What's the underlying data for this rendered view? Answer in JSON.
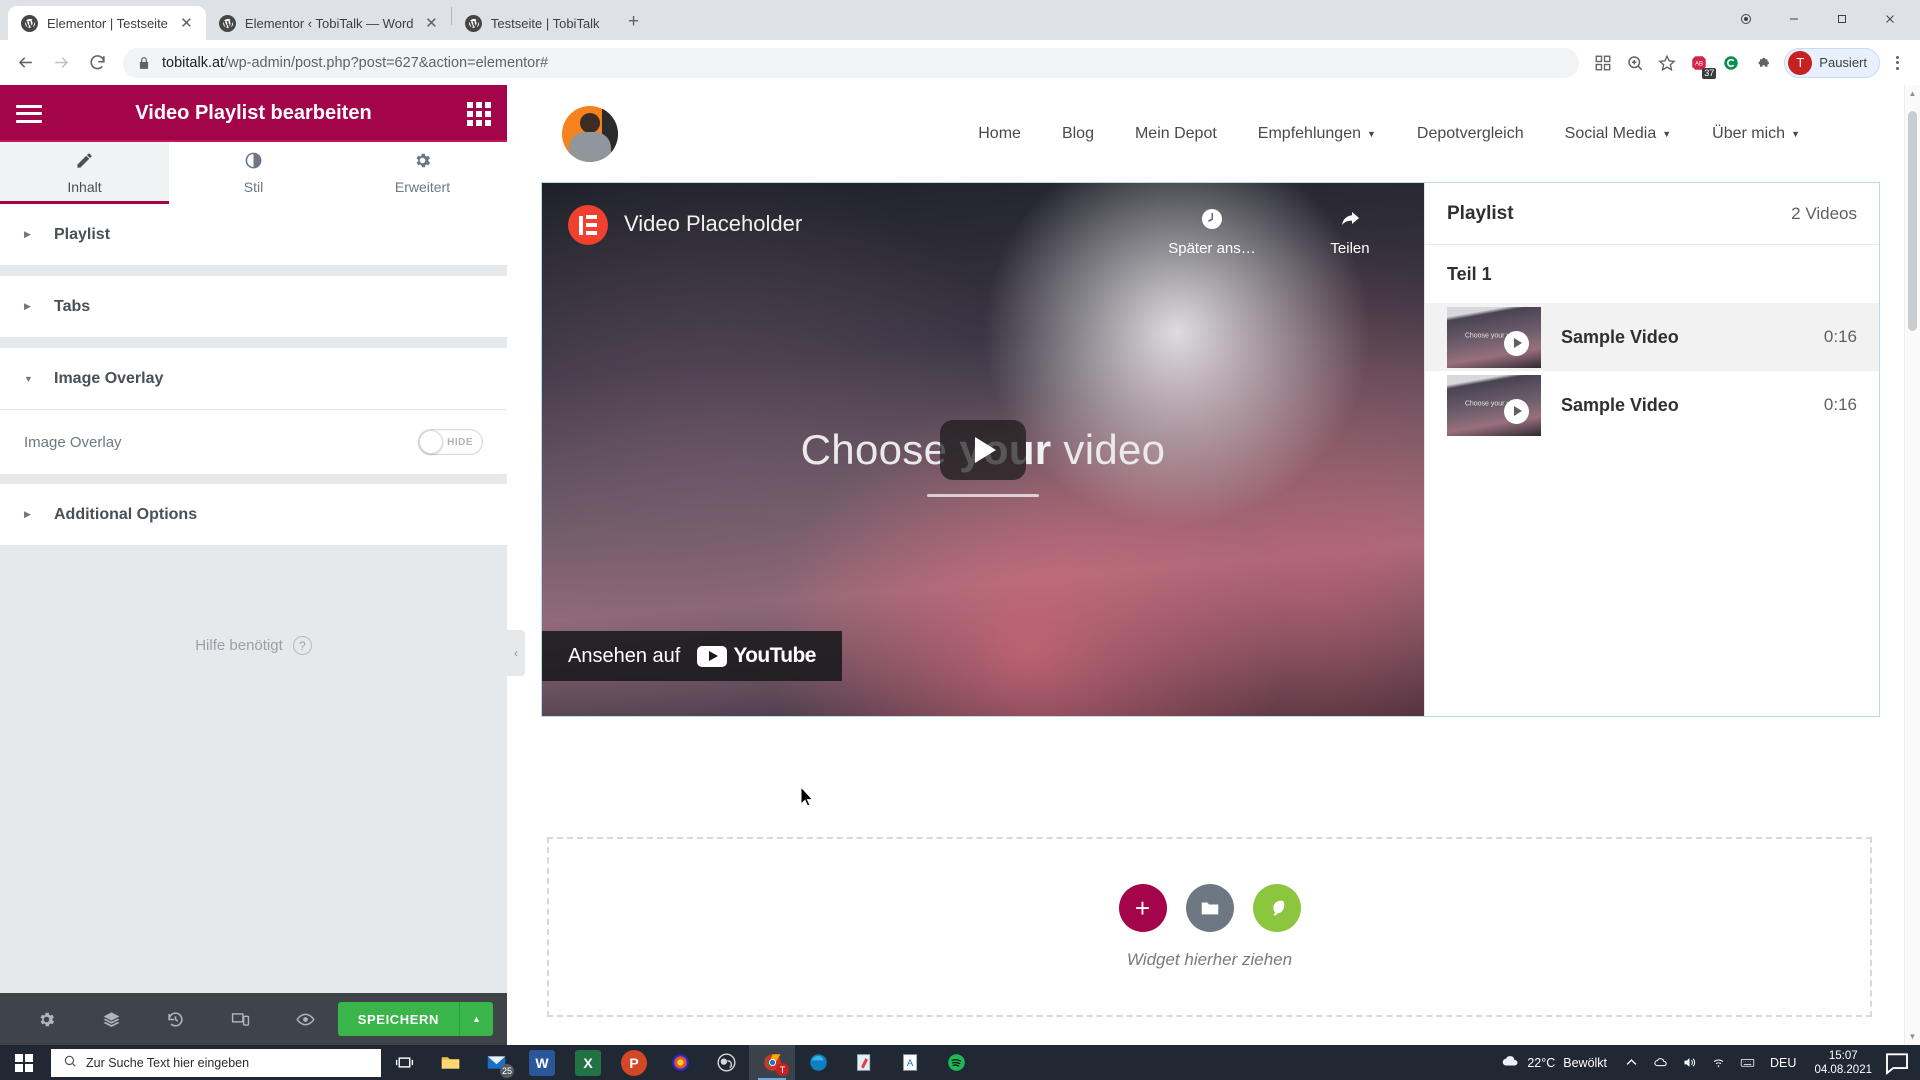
{
  "browser": {
    "tabs": [
      {
        "title": "Elementor | Testseite",
        "active": true,
        "icon": "wordpress-icon"
      },
      {
        "title": "Elementor ‹ TobiTalk — WordPre",
        "active": false,
        "icon": "wordpress-icon"
      },
      {
        "title": "Testseite | TobiTalk",
        "active": false,
        "icon": "wordpress-icon"
      }
    ],
    "new_tab_label": "+",
    "window_controls": {
      "minimize": "–",
      "maximize": "▢",
      "close": "✕"
    },
    "url_host": "tobitalk.at",
    "url_path": "/wp-admin/post.php?post=627&action=elementor#",
    "extensions": [
      {
        "name": "qr-code-icon",
        "badge": ""
      },
      {
        "name": "zoom-search-icon",
        "badge": ""
      },
      {
        "name": "bookmark-star-icon",
        "badge": ""
      },
      {
        "name": "adblock-icon",
        "badge": "37"
      },
      {
        "name": "cookie-consent-icon",
        "badge": ""
      },
      {
        "name": "extensions-puzzle-icon",
        "badge": ""
      }
    ],
    "profile": {
      "initial": "T",
      "status": "Pausiert"
    }
  },
  "panel": {
    "title": "Video Playlist bearbeiten",
    "menu_icon": "hamburger-menu-icon",
    "widgets_icon": "widgets-grid-icon",
    "tabs": [
      {
        "label": "Inhalt",
        "icon": "pencil-icon",
        "active": true
      },
      {
        "label": "Stil",
        "icon": "contrast-circle-icon",
        "active": false
      },
      {
        "label": "Erweitert",
        "icon": "gear-icon",
        "active": false
      }
    ],
    "sections": [
      {
        "label": "Playlist",
        "expanded": false
      },
      {
        "label": "Tabs",
        "expanded": false
      },
      {
        "label": "Image Overlay",
        "expanded": true
      },
      {
        "label": "Additional Options",
        "expanded": false
      }
    ],
    "image_overlay_control": {
      "label": "Image Overlay",
      "switch_label": "HIDE",
      "state": "off"
    },
    "help": {
      "label": "Hilfe benötigt",
      "icon": "question-mark-icon"
    },
    "footer": {
      "icons": [
        "settings-gear-icon",
        "navigator-layers-icon",
        "history-icon",
        "responsive-mode-icon",
        "preview-eye-icon"
      ],
      "save_label": "SPEICHERN",
      "save_caret": "▲"
    },
    "collapse_handle": "‹",
    "accent_color": "#a4054a",
    "save_color": "#39b54a"
  },
  "site": {
    "logo_alt": "profile-avatar",
    "nav": [
      {
        "label": "Home",
        "has_dropdown": false
      },
      {
        "label": "Blog",
        "has_dropdown": false
      },
      {
        "label": "Mein Depot",
        "has_dropdown": false
      },
      {
        "label": "Empfehlungen",
        "has_dropdown": true
      },
      {
        "label": "Depotvergleich",
        "has_dropdown": false
      },
      {
        "label": "Social Media",
        "has_dropdown": true
      },
      {
        "label": "Über mich",
        "has_dropdown": true
      }
    ],
    "video": {
      "title": "Video Placeholder",
      "brand_icon": "elementor-logo-icon",
      "actions": [
        {
          "label": "Später ans…",
          "icon": "watch-later-clock-icon"
        },
        {
          "label": "Teilen",
          "icon": "share-arrow-icon"
        }
      ],
      "center_text_1": "Choose ",
      "center_text_bold": "your",
      "center_text_2": " video",
      "watch_on_label": "Ansehen auf",
      "youtube_wordmark": "YouTube"
    },
    "playlist": {
      "heading": "Playlist",
      "count": "2 Videos",
      "section": "Teil 1",
      "items": [
        {
          "name": "Sample Video",
          "duration": "0:16",
          "active": true,
          "thumb_text": "Choose your video"
        },
        {
          "name": "Sample Video",
          "duration": "0:16",
          "active": false,
          "thumb_text": "Choose your video"
        }
      ]
    },
    "dropzone": {
      "text": "Widget hierher ziehen",
      "buttons": [
        {
          "name": "add-section-button",
          "icon": "plus-icon",
          "color": "#a4054a"
        },
        {
          "name": "add-template-button",
          "icon": "folder-icon",
          "color": "#6d7882"
        },
        {
          "name": "envato-kit-button",
          "icon": "leaf-icon",
          "color": "#8cc63e"
        }
      ]
    }
  },
  "taskbar": {
    "start_icon": "windows-start-icon",
    "search_placeholder": "Zur Suche Text hier eingeben",
    "search_icon": "search-icon",
    "task_view_icon": "task-view-icon",
    "apps": [
      {
        "name": "file-explorer-icon",
        "label": ""
      },
      {
        "name": "mail-icon",
        "label": "25"
      },
      {
        "name": "word-icon",
        "label": "W"
      },
      {
        "name": "excel-icon",
        "label": "X"
      },
      {
        "name": "powerpoint-icon",
        "label": "P"
      },
      {
        "name": "firefox-icon",
        "label": ""
      },
      {
        "name": "obs-studio-icon",
        "label": ""
      },
      {
        "name": "chrome-icon",
        "label": ""
      },
      {
        "name": "edge-icon",
        "label": ""
      },
      {
        "name": "snipping-tool-icon",
        "label": ""
      },
      {
        "name": "notepad-icon",
        "label": "A"
      },
      {
        "name": "spotify-icon",
        "label": ""
      }
    ],
    "weather": {
      "icon": "cloud-icon",
      "temperature": "22°C",
      "condition": "Bewölkt"
    },
    "tray": [
      "chevron-up-icon",
      "onedrive-icon",
      "volume-icon",
      "network-icon",
      "keyboard-icon"
    ],
    "language": "DEU",
    "time": "15:07",
    "date": "04.08.2021",
    "notification_icon": "notification-icon"
  }
}
